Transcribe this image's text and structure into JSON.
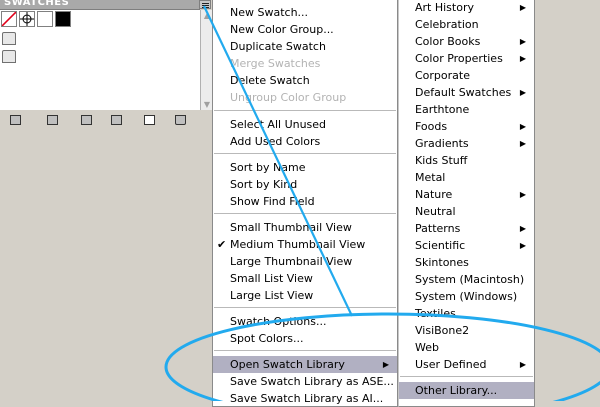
{
  "panel": {
    "tab_label": "SWATCHES",
    "menu_button_icon": "panel-menu-icon",
    "toolbar_icons": [
      "swatch-library-icon",
      "show-kinds-icon",
      "swatch-options-icon",
      "new-color-group-icon",
      "new-swatch-icon",
      "trash-icon"
    ]
  },
  "flyout_menu": {
    "items": [
      {
        "label": "New Swatch...",
        "enabled": true
      },
      {
        "label": "New Color Group...",
        "enabled": true
      },
      {
        "label": "Duplicate Swatch",
        "enabled": true
      },
      {
        "label": "Merge Swatches",
        "enabled": false
      },
      {
        "label": "Delete Swatch",
        "enabled": true
      },
      {
        "label": "Ungroup Color Group",
        "enabled": false
      },
      {
        "label": "Select All Unused",
        "enabled": true
      },
      {
        "label": "Add Used Colors",
        "enabled": true
      },
      {
        "label": "Sort by Name",
        "enabled": true
      },
      {
        "label": "Sort by Kind",
        "enabled": true
      },
      {
        "label": "Show Find Field",
        "enabled": true
      },
      {
        "label": "Small Thumbnail View",
        "enabled": true
      },
      {
        "label": "Medium Thumbnail View",
        "enabled": true,
        "checked": true
      },
      {
        "label": "Large Thumbnail View",
        "enabled": true
      },
      {
        "label": "Small List View",
        "enabled": true
      },
      {
        "label": "Large List View",
        "enabled": true
      },
      {
        "label": "Swatch Options...",
        "enabled": true
      },
      {
        "label": "Spot Colors...",
        "enabled": true
      },
      {
        "label": "Open Swatch Library",
        "enabled": true,
        "submenu": true,
        "highlighted": true
      },
      {
        "label": "Save Swatch Library as ASE...",
        "enabled": true
      },
      {
        "label": "Save Swatch Library as AI...",
        "enabled": true
      }
    ]
  },
  "library_menu": {
    "items": [
      {
        "label": "Art History",
        "submenu": true
      },
      {
        "label": "Celebration"
      },
      {
        "label": "Color Books",
        "submenu": true
      },
      {
        "label": "Color Properties",
        "submenu": true
      },
      {
        "label": "Corporate"
      },
      {
        "label": "Default Swatches",
        "submenu": true
      },
      {
        "label": "Earthtone"
      },
      {
        "label": "Foods",
        "submenu": true
      },
      {
        "label": "Gradients",
        "submenu": true
      },
      {
        "label": "Kids Stuff"
      },
      {
        "label": "Metal"
      },
      {
        "label": "Nature",
        "submenu": true
      },
      {
        "label": "Neutral"
      },
      {
        "label": "Patterns",
        "submenu": true
      },
      {
        "label": "Scientific",
        "submenu": true
      },
      {
        "label": "Skintones"
      },
      {
        "label": "System (Macintosh)"
      },
      {
        "label": "System (Windows)"
      },
      {
        "label": "Textiles"
      },
      {
        "label": "VisiBone2"
      },
      {
        "label": "Web"
      },
      {
        "label": "User Defined",
        "submenu": true
      },
      {
        "label": "Other Library...",
        "highlighted": true
      }
    ]
  },
  "symbols": {
    "submenu_arrow": "▶",
    "checkmark": "✔"
  },
  "colors": {
    "highlight": "#b1b0c2",
    "annotation": "#22aaee",
    "disabled_text": "#b3b3b3"
  }
}
